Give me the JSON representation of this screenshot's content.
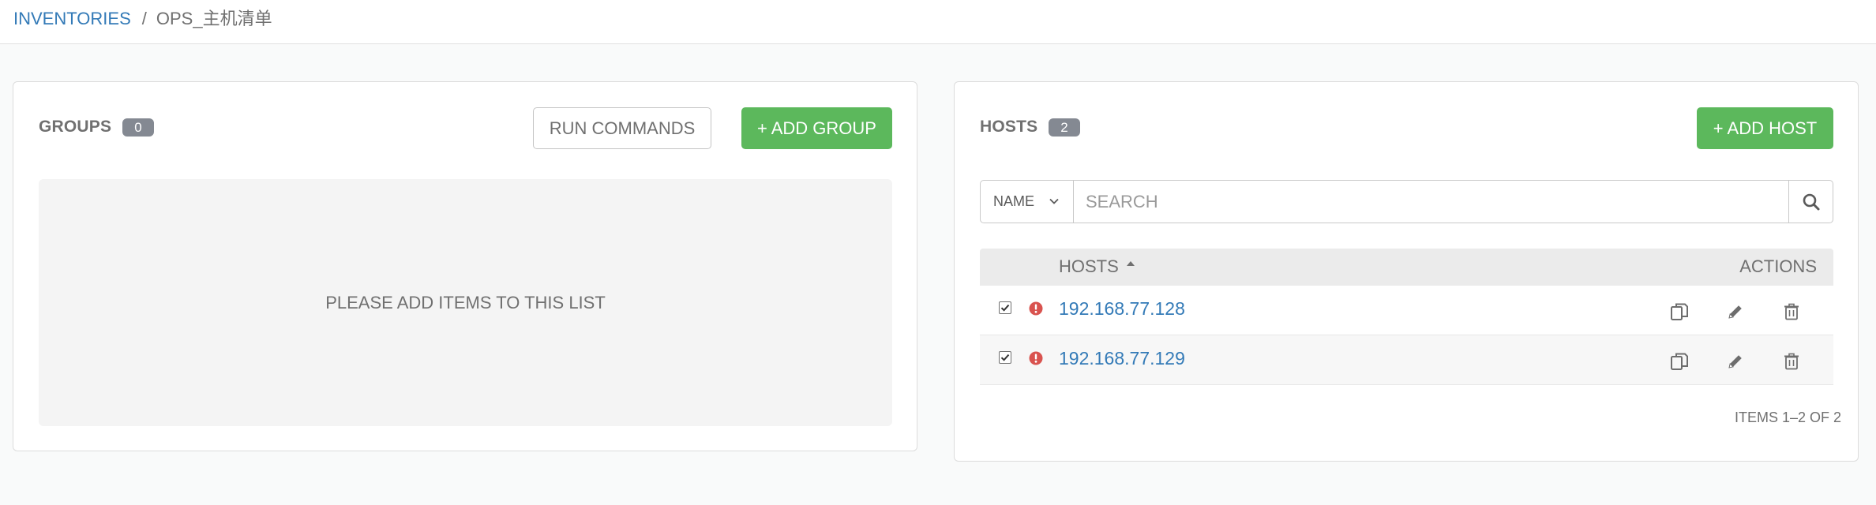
{
  "breadcrumb": {
    "root": "INVENTORIES",
    "separator": "/",
    "current": "OPS_主机清单"
  },
  "groups_panel": {
    "title": "GROUPS",
    "count": "0",
    "run_commands_label": "RUN COMMANDS",
    "add_group_label": "+ ADD GROUP",
    "empty_message": "PLEASE ADD ITEMS TO THIS LIST"
  },
  "hosts_panel": {
    "title": "HOSTS",
    "count": "2",
    "add_host_label": "+ ADD HOST",
    "search": {
      "field_label": "NAME",
      "placeholder": "SEARCH",
      "value": ""
    },
    "table": {
      "columns": {
        "hosts": "HOSTS",
        "actions": "ACTIONS"
      },
      "sort": "ascending",
      "rows": [
        {
          "name": "192.168.77.128",
          "enabled": true,
          "status": "failed"
        },
        {
          "name": "192.168.77.129",
          "enabled": true,
          "status": "failed"
        }
      ]
    },
    "pagination": "ITEMS 1–2 OF 2"
  },
  "colors": {
    "link": "#337ab7",
    "accent_green": "#5cb85c",
    "badge": "#848992",
    "error": "#d9534f"
  },
  "icons": {
    "sort": "caret-up-icon",
    "status": "exclamation-circle-icon",
    "copy": "copy-icon",
    "edit": "pencil-icon",
    "delete": "trash-icon",
    "search": "search-icon"
  }
}
